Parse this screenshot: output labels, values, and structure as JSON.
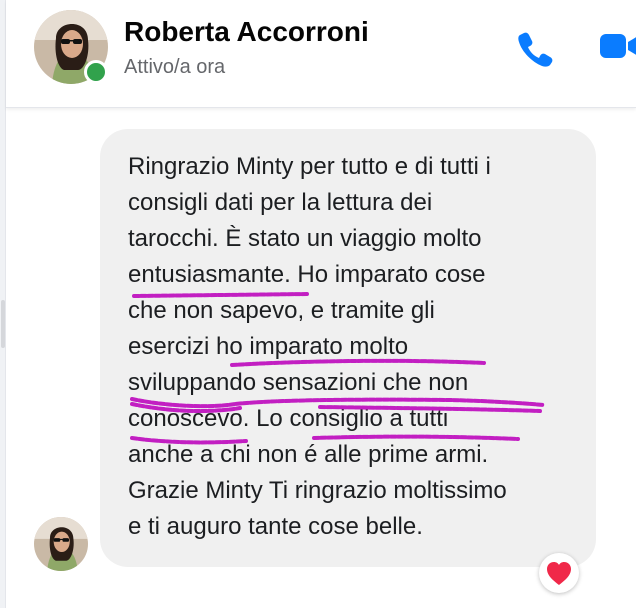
{
  "header": {
    "contact_name": "Roberta Accorroni",
    "status": "Attivo/a ora",
    "avatar_icon": "person-photo-avatar",
    "online_color": "#31a24c",
    "call_icon": "phone-icon",
    "video_icon": "video-camera-icon",
    "accent_color": "#0a7cff"
  },
  "message": {
    "lines": [
      "Ringrazio Minty per tutto e di tutti i",
      "consigli dati per la lettura dei",
      "tarocchi. È stato un viaggio molto",
      "entusiasmante. Ho imparato cose",
      "che non sapevo, e tramite gli",
      "esercizi ho imparato molto",
      "sviluppando sensazioni che non",
      "conoscevo. Lo consiglio a tutti",
      "anche a chi non é alle prime armi.",
      "Grazie Minty Ti ringrazio moltissimo",
      "e ti auguro tante cose belle."
    ],
    "highlight_color": "#c21fc2",
    "bubble_color": "#f0f0f0",
    "reaction_icon": "heart-icon",
    "reaction_color": "#f02849"
  }
}
